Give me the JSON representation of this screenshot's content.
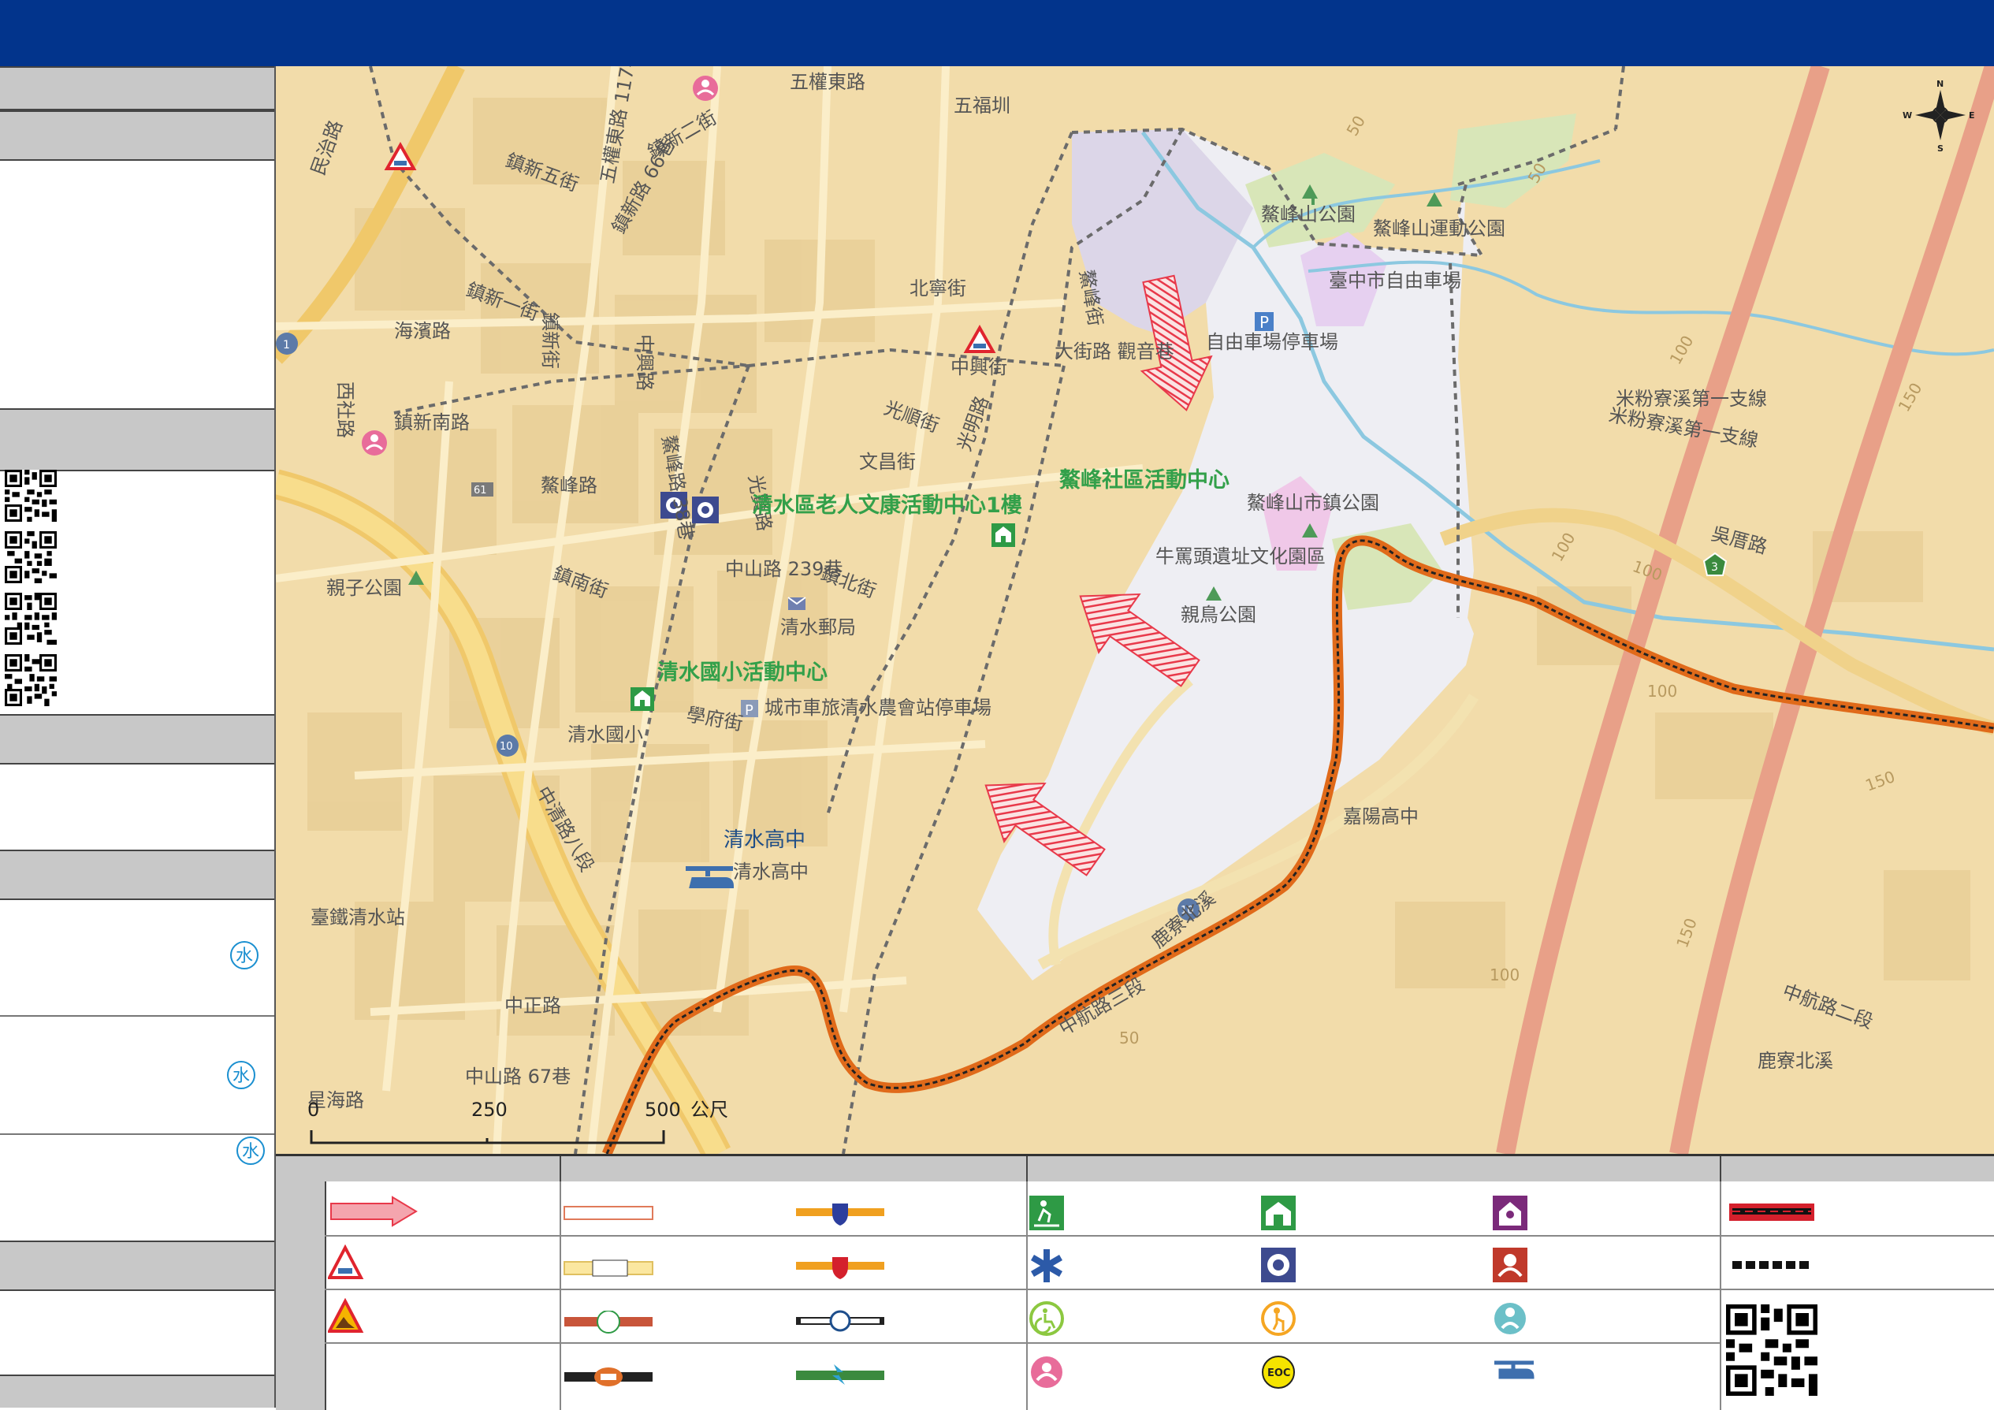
{
  "map": {
    "labels": {
      "wuquan_e": "五權東路",
      "wufu": "五福圳",
      "wuquan_117": "五權東路 117巷",
      "zhenxin2": "鎮新二街",
      "zhenxin5": "鎮新五街",
      "zhenxin66": "鎮新路 66巷",
      "zhenxin1": "鎮新一街",
      "minzhi": "民治路",
      "haibin": "海濱路",
      "xishe": "西社路",
      "zhenxin_s": "鎮新南路",
      "zhenxin_st": "鎮新街",
      "zhongxing_st": "中興街",
      "beining": "北寧街",
      "guangshun": "光順街",
      "zhongxing_rd": "中興路",
      "wenchang": "文昌街",
      "guangming": "光明路",
      "daqiao_guanyin": "大街路 觀音巷",
      "aofeng_st": "鰲峰街",
      "aofeng_rd": "鰲峰路",
      "aofeng_38": "鰲峰路 38巷",
      "zhenbei": "鎮北街",
      "zhennan": "鎮南街",
      "zhongshan_239": "中山路 239巷",
      "qingshui_post": "清水郵局",
      "guangxian": "光賢路",
      "qinzi_park": "親子公園",
      "xueyuan": "學府街",
      "parking_farm": "城市車旅清水農會站停車場",
      "qingshui_elem": "清水國小",
      "qingshui_high_sub": "清水高中",
      "taitie": "臺鐵清水站",
      "zhongqing8": "中清路八段",
      "zhongzheng": "中正路",
      "zhongshan67": "中山路 67巷",
      "xinghai": "星海路",
      "zhonghang3": "中航路三段",
      "zhonghang2": "中航路二段",
      "lukexi_n": "鹿寮北溪",
      "lukexi": "鹿寮北溪",
      "aofengshan_park": "鰲峰山公園",
      "aofengshan_sport": "鰲峰山運動公園",
      "ziyou_field": "臺中市自由車場",
      "ziyou_parking": "自由車場停車場",
      "aofengshan_town": "鰲峰山市鎮公園",
      "niumatou": "牛罵頭遺址文化園區",
      "qinniao": "親鳥公園",
      "mifen_creek": "米粉寮溪第一支線",
      "mifen_creek2": "米粉寮溪第一支線",
      "jiayang": "嘉陽高中",
      "wuliao": "吳厝路",
      "shijiang": "中山路",
      "c1": "50",
      "c2": "50",
      "c3": "100",
      "c4": "100",
      "c5": "100",
      "c6": "150",
      "c7": "150",
      "c8": "100",
      "c9": "150",
      "c10": "100",
      "c11": "50"
    },
    "shelters": {
      "s1": "清水區老人文康活動中心1樓",
      "s2": "鰲峰社區活動中心",
      "s3": "清水國小活動中心",
      "s4": "清水高中"
    },
    "scale": {
      "t0": "0",
      "t1": "250",
      "t2": "500",
      "unit": "公尺"
    },
    "compass": {
      "n": "N",
      "s": "S",
      "e": "E",
      "w": "W"
    },
    "route_markers": {
      "r1": "1",
      "r61": "61",
      "r10": "10",
      "r3": "3",
      "r10b": "10"
    },
    "colors": {
      "base": "#f2dcaa",
      "alert_zone": "#e9e8f0",
      "evac_arrow": "#e8394a",
      "boundary": "#d9621a",
      "park": "#d8e6b8"
    }
  },
  "sidebar": {
    "water_icon": "水"
  },
  "legend": {
    "icons": {
      "evac_arrow": "evacuation-arrow-icon",
      "debris_flow": "debris-flow-warning-icon",
      "landslide": "landslide-warning-icon",
      "shelter_outdoor": "outdoor-shelter-icon",
      "shelter_indoor": "indoor-shelter-icon",
      "social_welfare": "social-welfare-icon",
      "medical": "medical-icon",
      "police": "police-icon",
      "fire": "fire-station-icon",
      "accessible": "accessible-icon",
      "elderly": "elderly-care-icon",
      "child": "child-care-icon",
      "women": "women-children-icon",
      "eoc": "eoc-icon",
      "helicopter": "helicopter-icon",
      "qr": "qr-code-icon"
    },
    "eoc_text": "EOC"
  }
}
